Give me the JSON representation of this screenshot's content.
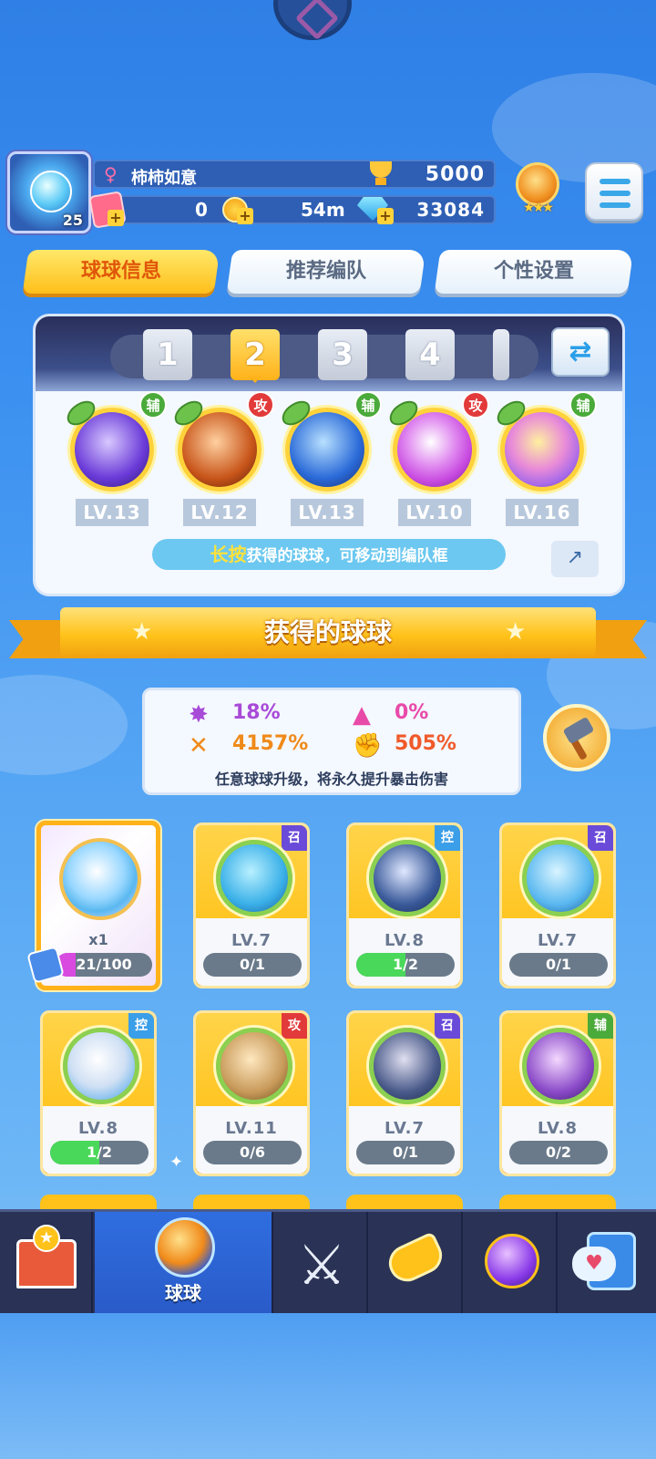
{
  "player": {
    "name": "柿柿如意",
    "level": "25",
    "gender_icon": "female-icon"
  },
  "resources": {
    "trophy": "5000",
    "tickets": "0",
    "coin_timer": "54m",
    "gems": "33084"
  },
  "tabs": [
    {
      "label": "球球信息",
      "active": true
    },
    {
      "label": "推荐编队",
      "active": false
    },
    {
      "label": "个性设置",
      "active": false
    }
  ],
  "team": {
    "slots": [
      "1",
      "2",
      "3",
      "4"
    ],
    "selected": "2",
    "balls": [
      {
        "role": "辅",
        "level": "LV.13",
        "color": "#6a3ad8"
      },
      {
        "role": "攻",
        "level": "LV.12",
        "color": "#c8551a"
      },
      {
        "role": "辅",
        "level": "LV.13",
        "color": "#2a6ad8"
      },
      {
        "role": "攻",
        "level": "LV.10",
        "color": "#c84ae0"
      },
      {
        "role": "辅",
        "level": "LV.16",
        "color": "#a86ae8"
      }
    ],
    "hint_highlight": "长按",
    "hint_text": "获得的球球，可移动到编队框"
  },
  "section_title": "获得的球球",
  "stats": {
    "crit_rate": "18%",
    "crit_bonus": "0%",
    "crit_damage": "4157%",
    "power": "505%",
    "note": "任意球球升级，将永久提升暴击伤害"
  },
  "special_card": {
    "multiplier": "x1",
    "progress": "21/100",
    "fill": 0.21
  },
  "cards": [
    {
      "role": "召",
      "level": "LV.7",
      "progress": "0/1",
      "fill": 0,
      "color": "#3ab0e8"
    },
    {
      "role": "控",
      "level": "LV.8",
      "progress": "1/2",
      "fill": 0.5,
      "color": "#3a5a9a"
    },
    {
      "role": "召",
      "level": "LV.7",
      "progress": "0/1",
      "fill": 0,
      "color": "#5ab8f0"
    },
    {
      "role": "控",
      "level": "LV.8",
      "progress": "1/2",
      "fill": 0.5,
      "color": "#f0f4fa"
    },
    {
      "role": "攻",
      "level": "LV.11",
      "progress": "0/6",
      "fill": 0,
      "color": "#c89a5a"
    },
    {
      "role": "召",
      "level": "LV.7",
      "progress": "0/1",
      "fill": 0,
      "color": "#4a5a8a"
    },
    {
      "role": "辅",
      "level": "LV.8",
      "progress": "0/2",
      "fill": 0,
      "color": "#8a4ac8"
    }
  ],
  "nav": [
    {
      "icon": "shop-icon",
      "label": ""
    },
    {
      "icon": "balls-icon",
      "label": "球球",
      "selected": true
    },
    {
      "icon": "swords-icon",
      "label": ""
    },
    {
      "icon": "whistle-icon",
      "label": ""
    },
    {
      "icon": "planet-icon",
      "label": ""
    },
    {
      "icon": "chat-icon",
      "label": ""
    }
  ]
}
